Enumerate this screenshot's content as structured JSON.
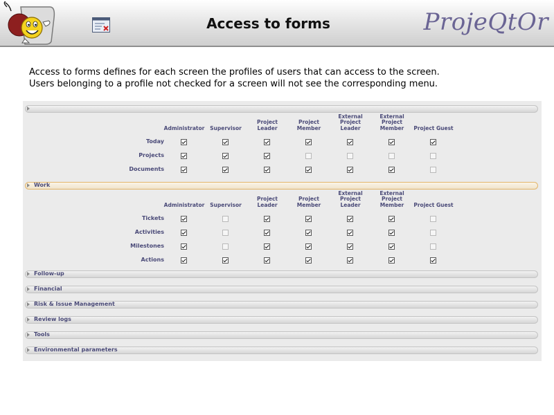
{
  "header": {
    "title": "Access to forms",
    "brand": "ProjeQtOr",
    "logo_icon": "projeqtor-smiley-logo",
    "form_icon": "form-window-icon"
  },
  "intro": {
    "line1": "Access to forms defines for each screen the profiles of users that can access to the screen.",
    "line2": "Users belonging to a profile not checked for a screen will not see the corresponding menu."
  },
  "profiles": [
    {
      "lines": [
        "Administrator"
      ]
    },
    {
      "lines": [
        "Supervisor"
      ]
    },
    {
      "lines": [
        "Project",
        "Leader"
      ]
    },
    {
      "lines": [
        "Project",
        "Member"
      ]
    },
    {
      "lines": [
        "External",
        "Project",
        "Leader"
      ]
    },
    {
      "lines": [
        "External",
        "Project",
        "Member"
      ]
    },
    {
      "lines": [
        "Project Guest"
      ]
    }
  ],
  "sections": [
    {
      "label": "",
      "expanded": true,
      "rows": [
        {
          "label": "Today",
          "access": [
            true,
            true,
            true,
            true,
            true,
            true,
            true
          ]
        },
        {
          "label": "Projects",
          "access": [
            true,
            true,
            true,
            false,
            false,
            false,
            false
          ]
        },
        {
          "label": "Documents",
          "access": [
            true,
            true,
            true,
            true,
            true,
            true,
            false
          ]
        }
      ]
    },
    {
      "label": "Work",
      "expanded": true,
      "rows": [
        {
          "label": "Tickets",
          "access": [
            true,
            false,
            true,
            true,
            true,
            true,
            false
          ]
        },
        {
          "label": "Activities",
          "access": [
            true,
            false,
            true,
            true,
            true,
            true,
            false
          ]
        },
        {
          "label": "Milestones",
          "access": [
            true,
            false,
            true,
            true,
            true,
            true,
            false
          ]
        },
        {
          "label": "Actions",
          "access": [
            true,
            true,
            true,
            true,
            true,
            true,
            true
          ]
        }
      ]
    },
    {
      "label": "Follow-up",
      "expanded": false,
      "rows": []
    },
    {
      "label": "Financial",
      "expanded": false,
      "rows": []
    },
    {
      "label": "Risk & Issue Management",
      "expanded": false,
      "rows": []
    },
    {
      "label": "Review logs",
      "expanded": false,
      "rows": []
    },
    {
      "label": "Tools",
      "expanded": false,
      "rows": []
    },
    {
      "label": "Environmental parameters",
      "expanded": false,
      "rows": []
    }
  ]
}
